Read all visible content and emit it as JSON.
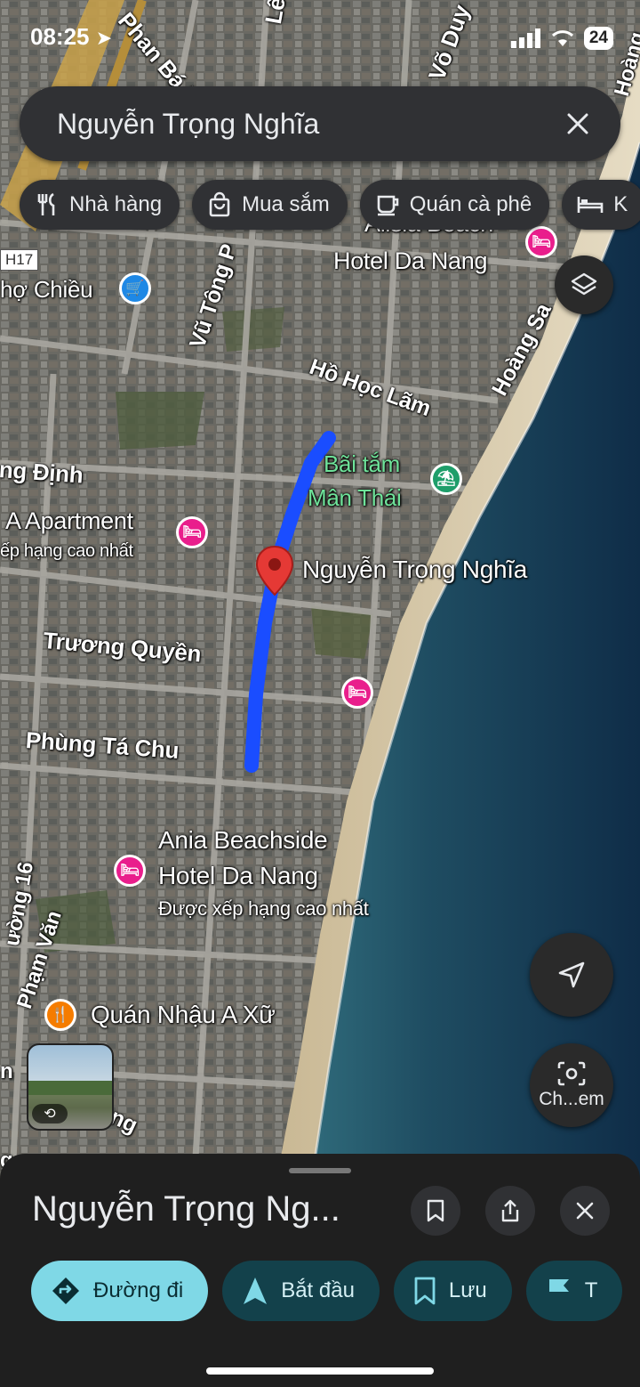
{
  "status_bar": {
    "time": "08:25",
    "battery": "24"
  },
  "search": {
    "query": "Nguyễn Trọng Nghĩa"
  },
  "chips": [
    {
      "label": "Nhà hàng",
      "icon": "fork-knife-icon"
    },
    {
      "label": "Mua sắm",
      "icon": "shopping-bag-icon"
    },
    {
      "label": "Quán cà phê",
      "icon": "coffee-icon"
    },
    {
      "label": "K",
      "icon": "bed-icon"
    }
  ],
  "map_labels": {
    "phan_bap": "Phan Bá P",
    "le": "Lê",
    "vo_duy": "Võ Duy",
    "hoang_top": "Hoàng",
    "h17": "H17",
    "cho_chieu": "hợ Chiều",
    "vu_tong": "Vũ Tông P",
    "alisia_line1": "Alisia Beach",
    "alisia_line2": "Hotel Da Nang",
    "hoang_sa": "Hoàng Sa",
    "ho_hoc_lam": "Hồ Học Lãm",
    "bai_tam_1": "Bãi tắm",
    "bai_tam_2": "Mân Thái",
    "ung_dinh": "ng Định",
    "apartment": "A Apartment",
    "apartment_sub": "ếp hạng cao nhất",
    "selected_street": "Nguyễn Trọng Nghĩa",
    "truong_quyen": "Trương Quyền",
    "phung_ta_chu": "Phùng Tá Chu",
    "ania_1": "Ania Beachside",
    "ania_2": "Hotel Da Nang",
    "ania_sub": "Được xếp hạng cao nhất",
    "duong16": "ường 16",
    "pham_van": "Phạm Văn",
    "quan_nhau": "Quán Nhậu A Xữ",
    "ong": "ông",
    "sidelabel_n": "n",
    "sidelabel_g": "g"
  },
  "map_buttons": {
    "camera_label": "Ch...em"
  },
  "place_sheet": {
    "title": "Nguyễn Trọng Ng...",
    "actions": [
      {
        "label": "Đường đi",
        "icon": "directions-icon"
      },
      {
        "label": "Bắt đầu",
        "icon": "navigation-arrow-icon"
      },
      {
        "label": "Lưu",
        "icon": "bookmark-icon"
      },
      {
        "label": "T",
        "icon": "flag-icon"
      }
    ]
  },
  "colors": {
    "route": "#1a4dff",
    "pin": "#e53935",
    "hotel_pin": "#e91e8c",
    "shopping_pin": "#1e88e5",
    "restaurant_pin": "#f57c00",
    "beach_pin": "#1e9e6a",
    "primary_action": "#7fd8e6"
  }
}
